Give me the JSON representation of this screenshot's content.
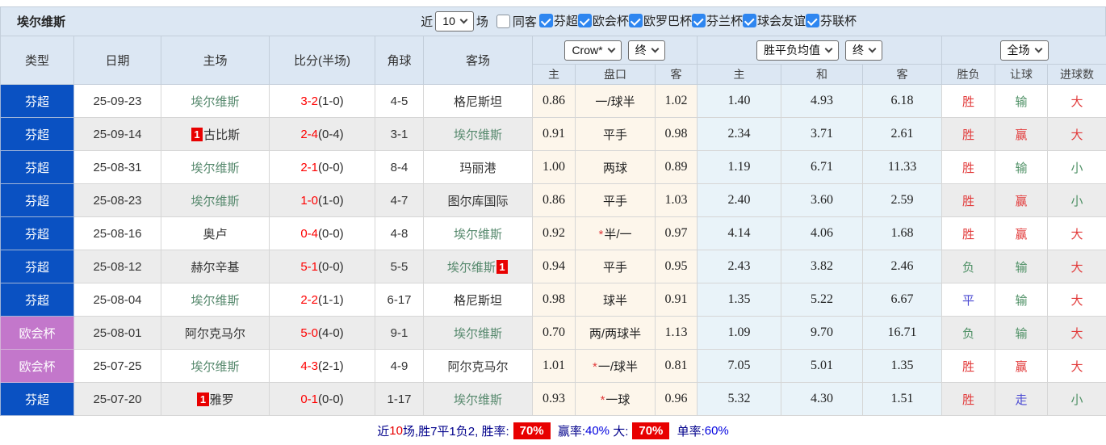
{
  "header": {
    "team_title": "埃尔维斯",
    "recent_label": "近",
    "recent_count": "10",
    "matches_label": "场",
    "same_away_label": "同客",
    "same_away_checked": false,
    "filters": [
      {
        "label": "芬超",
        "cb": "checked"
      },
      {
        "label": "欧会杯",
        "cb": "checked"
      },
      {
        "label": "欧罗巴杯",
        "cb": "checked"
      },
      {
        "label": "芬兰杯",
        "cb": "checked"
      },
      {
        "label": "球会友谊",
        "cb": "checked"
      },
      {
        "label": "芬联杯",
        "cb": "checked"
      }
    ]
  },
  "table": {
    "columns": [
      "类型",
      "日期",
      "主场",
      "比分(半场)",
      "角球",
      "客场"
    ],
    "sub_columns": [
      "主",
      "盘口",
      "客",
      "主",
      "和",
      "客",
      "胜负",
      "让球",
      "进球数"
    ],
    "controls": {
      "bookmaker": "Crow*",
      "odds_time": "终",
      "mean": "胜平负均值",
      "mean_time": "终",
      "scope": "全场"
    }
  },
  "rows": [
    {
      "league": {
        "text": "芬超",
        "color": "lg-blue"
      },
      "date": "25-09-23",
      "home": {
        "name": "埃尔维斯",
        "color": "green"
      },
      "score": {
        "main": "3-2",
        "half": "(1-0)"
      },
      "corners": "4-5",
      "away": {
        "name": "格尼斯坦",
        "color": "dark"
      },
      "odds": {
        "home": "0.86",
        "handicap": "一/球半",
        "away": "1.02"
      },
      "mean": {
        "home": "1.40",
        "draw": "4.93",
        "away": "6.18"
      },
      "result": {
        "text": "胜",
        "color": "red"
      },
      "handicap_result": {
        "text": "输",
        "color": "green"
      },
      "goals_result": {
        "text": "大",
        "color": "red"
      }
    },
    {
      "league": {
        "text": "芬超",
        "color": "lg-blue"
      },
      "date": "25-09-14",
      "home": {
        "badge": "1",
        "name": "古比斯",
        "color": "dark"
      },
      "score": {
        "main": "2-4",
        "half": "(0-4)"
      },
      "corners": "3-1",
      "away": {
        "name": "埃尔维斯",
        "color": "green"
      },
      "odds": {
        "home": "0.91",
        "handicap": "平手",
        "away": "0.98"
      },
      "mean": {
        "home": "2.34",
        "draw": "3.71",
        "away": "2.61"
      },
      "result": {
        "text": "胜",
        "color": "red"
      },
      "handicap_result": {
        "text": "赢",
        "color": "red"
      },
      "goals_result": {
        "text": "大",
        "color": "red"
      }
    },
    {
      "league": {
        "text": "芬超",
        "color": "lg-blue"
      },
      "date": "25-08-31",
      "home": {
        "name": "埃尔维斯",
        "color": "green"
      },
      "score": {
        "main": "2-1",
        "half": "(0-0)"
      },
      "corners": "8-4",
      "away": {
        "name": "玛丽港",
        "color": "dark"
      },
      "odds": {
        "home": "1.00",
        "handicap": "两球",
        "away": "0.89"
      },
      "mean": {
        "home": "1.19",
        "draw": "6.71",
        "away": "11.33"
      },
      "result": {
        "text": "胜",
        "color": "red"
      },
      "handicap_result": {
        "text": "输",
        "color": "green"
      },
      "goals_result": {
        "text": "小",
        "color": "green"
      }
    },
    {
      "league": {
        "text": "芬超",
        "color": "lg-blue"
      },
      "date": "25-08-23",
      "home": {
        "name": "埃尔维斯",
        "color": "green"
      },
      "score": {
        "main": "1-0",
        "half": "(1-0)"
      },
      "corners": "4-7",
      "away": {
        "name": "图尔库国际",
        "color": "dark"
      },
      "odds": {
        "home": "0.86",
        "handicap": "平手",
        "away": "1.03"
      },
      "mean": {
        "home": "2.40",
        "draw": "3.60",
        "away": "2.59"
      },
      "result": {
        "text": "胜",
        "color": "red"
      },
      "handicap_result": {
        "text": "赢",
        "color": "red"
      },
      "goals_result": {
        "text": "小",
        "color": "green"
      }
    },
    {
      "league": {
        "text": "芬超",
        "color": "lg-blue"
      },
      "date": "25-08-16",
      "home": {
        "name": "奥卢",
        "color": "dark"
      },
      "score": {
        "main": "0-4",
        "half": "(0-0)"
      },
      "corners": "4-8",
      "away": {
        "name": "埃尔维斯",
        "color": "green"
      },
      "odds": {
        "home": "0.92",
        "star_text": "*",
        "handicap": "半/一",
        "away": "0.97"
      },
      "mean": {
        "home": "4.14",
        "draw": "4.06",
        "away": "1.68"
      },
      "result": {
        "text": "胜",
        "color": "red"
      },
      "handicap_result": {
        "text": "赢",
        "color": "red"
      },
      "goals_result": {
        "text": "大",
        "color": "red"
      }
    },
    {
      "league": {
        "text": "芬超",
        "color": "lg-blue"
      },
      "date": "25-08-12",
      "home": {
        "name": "赫尔辛基",
        "color": "dark"
      },
      "score": {
        "main": "5-1",
        "half": "(0-0)"
      },
      "corners": "5-5",
      "away": {
        "name": "埃尔维斯",
        "color": "green",
        "badge_after": "1"
      },
      "odds": {
        "home": "0.94",
        "handicap": "平手",
        "away": "0.95"
      },
      "mean": {
        "home": "2.43",
        "draw": "3.82",
        "away": "2.46"
      },
      "result": {
        "text": "负",
        "color": "green"
      },
      "handicap_result": {
        "text": "输",
        "color": "green"
      },
      "goals_result": {
        "text": "大",
        "color": "red"
      }
    },
    {
      "league": {
        "text": "芬超",
        "color": "lg-blue"
      },
      "date": "25-08-04",
      "home": {
        "name": "埃尔维斯",
        "color": "green"
      },
      "score": {
        "main": "2-2",
        "half": "(1-1)"
      },
      "corners": "6-17",
      "away": {
        "name": "格尼斯坦",
        "color": "dark"
      },
      "odds": {
        "home": "0.98",
        "handicap": "球半",
        "away": "0.91"
      },
      "mean": {
        "home": "1.35",
        "draw": "5.22",
        "away": "6.67"
      },
      "result": {
        "text": "平",
        "color": "blue"
      },
      "handicap_result": {
        "text": "输",
        "color": "green"
      },
      "goals_result": {
        "text": "大",
        "color": "red"
      }
    },
    {
      "league": {
        "text": "欧会杯",
        "color": "lg-purple"
      },
      "date": "25-08-01",
      "home": {
        "name": "阿尔克马尔",
        "color": "dark"
      },
      "score": {
        "main": "5-0",
        "half": "(4-0)"
      },
      "corners": "9-1",
      "away": {
        "name": "埃尔维斯",
        "color": "green"
      },
      "odds": {
        "home": "0.70",
        "handicap": "两/两球半",
        "away": "1.13"
      },
      "mean": {
        "home": "1.09",
        "draw": "9.70",
        "away": "16.71"
      },
      "result": {
        "text": "负",
        "color": "green"
      },
      "handicap_result": {
        "text": "输",
        "color": "green"
      },
      "goals_result": {
        "text": "大",
        "color": "red"
      }
    },
    {
      "league": {
        "text": "欧会杯",
        "color": "lg-purple"
      },
      "date": "25-07-25",
      "home": {
        "name": "埃尔维斯",
        "color": "green"
      },
      "score": {
        "main": "4-3",
        "half": "(2-1)"
      },
      "corners": "4-9",
      "away": {
        "name": "阿尔克马尔",
        "color": "dark"
      },
      "odds": {
        "home": "1.01",
        "star_text": "*",
        "handicap": "一/球半",
        "away": "0.81"
      },
      "mean": {
        "home": "7.05",
        "draw": "5.01",
        "away": "1.35"
      },
      "result": {
        "text": "胜",
        "color": "red"
      },
      "handicap_result": {
        "text": "赢",
        "color": "red"
      },
      "goals_result": {
        "text": "大",
        "color": "red"
      }
    },
    {
      "league": {
        "text": "芬超",
        "color": "lg-blue"
      },
      "date": "25-07-20",
      "home": {
        "badge": "1",
        "name": "雅罗",
        "color": "dark"
      },
      "score": {
        "main": "0-1",
        "half": "(0-0)"
      },
      "corners": "1-17",
      "away": {
        "name": "埃尔维斯",
        "color": "green"
      },
      "odds": {
        "home": "0.93",
        "star_text": "*",
        "handicap": "一球",
        "away": "0.96"
      },
      "mean": {
        "home": "5.32",
        "draw": "4.30",
        "away": "1.51"
      },
      "result": {
        "text": "胜",
        "color": "red"
      },
      "handicap_result": {
        "text": "走",
        "color": "blue"
      },
      "goals_result": {
        "text": "小",
        "color": "green"
      }
    }
  ],
  "summary": {
    "segments": [
      {
        "text": "近",
        "style": "navy"
      },
      {
        "text": "10",
        "style": "red"
      },
      {
        "text": "场,胜7平1负2, 胜率:",
        "style": "navy"
      },
      {
        "text": "70%",
        "style": "badge-seg"
      },
      {
        "text": " 赢率:",
        "style": "navy"
      },
      {
        "text": "40%",
        "style": "blue"
      },
      {
        "text": " 大:",
        "style": "navy"
      },
      {
        "text": "70%",
        "style": "badge-seg"
      },
      {
        "text": " 单率:",
        "style": "navy"
      },
      {
        "text": "60%",
        "style": "blue"
      }
    ]
  },
  "colors": {
    "header_bg": "#dce7f3",
    "league_blue": "#0a51c2",
    "league_purple": "#c377cb",
    "team_green": "#55886c",
    "result_red": "#e23b3b",
    "result_green": "#4e9065",
    "result_blue": "#4a49d2",
    "score_red": "#fe0000",
    "odds_bg": "#fdf6eb",
    "mean_bg": "#e9f3f9",
    "alt_row_bg": "#ececec",
    "badge_red": "#e80000",
    "checkbox_blue": "#2e86f0",
    "footer_navy": "#00008b",
    "footer_blue": "#0000e0"
  }
}
